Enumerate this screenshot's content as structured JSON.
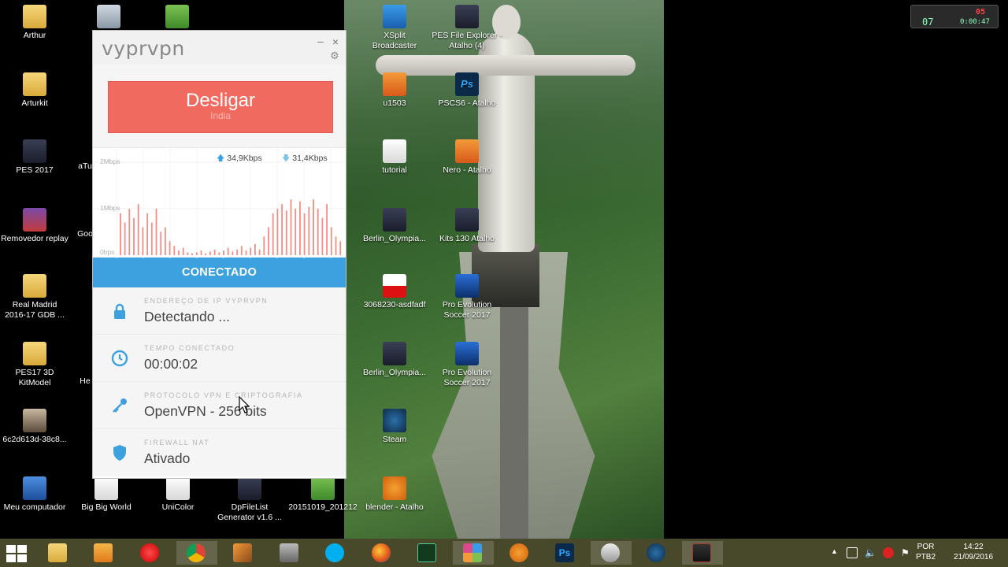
{
  "vpn": {
    "logo": "vyprvpn",
    "disconnect_label": "Desligar",
    "disconnect_sub": "India",
    "upload_rate": "34,9Kbps",
    "download_rate": "31,4Kbps",
    "graph_labels": [
      "2Mbps",
      "1Mbps",
      "0bps"
    ],
    "status": "CONECTADO",
    "rows": [
      {
        "label": "Endereço de IP VyprVPN",
        "value": "Detectando ...",
        "icon": "lock-icon"
      },
      {
        "label": "Tempo conectado",
        "value": "00:00:02",
        "icon": "clock-icon"
      },
      {
        "label": "Protocolo VPN e criptografia",
        "value": "OpenVPN - 256 bits",
        "icon": "key-icon"
      },
      {
        "label": "Firewall NAT",
        "value": "Ativado",
        "icon": "shield-icon"
      }
    ],
    "accent": "#3da1e0",
    "disconnect_color": "#f06a5f"
  },
  "desktop_icons": [
    {
      "label": "Arthur",
      "icon": "folder-icon"
    },
    {
      "label": "Arturkit",
      "icon": "folder-icon"
    },
    {
      "label": "PES 2017",
      "icon": "game-icon"
    },
    {
      "label": "Removedor replay",
      "icon": "winrar-icon"
    },
    {
      "label": "Real Madrid 2016-17 GDB ...",
      "icon": "folder-icon"
    },
    {
      "label": "PES17 3D KitModel",
      "icon": "folder-icon"
    },
    {
      "label": "6c2d613d-38c8...",
      "icon": "image-icon"
    },
    {
      "label": "Meu computador",
      "icon": "computer-icon"
    },
    {
      "label": "Big Big World",
      "icon": "audio-file-icon"
    },
    {
      "label": "UniColor",
      "icon": "app-icon"
    },
    {
      "label": "DpFileList Generator v1.6 ...",
      "icon": "app-icon"
    },
    {
      "label": "20151019_201212",
      "icon": "image-icon"
    },
    {
      "label": "XSplit Broadcaster",
      "icon": "xsplit-icon"
    },
    {
      "label": "PES File Explorer - Atalho (4)",
      "icon": "app-icon"
    },
    {
      "label": "u1503",
      "icon": "app-icon"
    },
    {
      "label": "PSCS6 - Atalho",
      "icon": "photoshop-icon"
    },
    {
      "label": "tutorial",
      "icon": "text-file-icon"
    },
    {
      "label": "Nero - Atalho",
      "icon": "nero-icon"
    },
    {
      "label": "Berlin_Olympia...",
      "icon": "image-icon"
    },
    {
      "label": "Kits 130 Atalho",
      "icon": "app-icon"
    },
    {
      "label": "3068230-asdfadf",
      "icon": "image-icon"
    },
    {
      "label": "Pro Evolution Soccer 2017",
      "icon": "game-icon"
    },
    {
      "label": "Berlin_Olympia...",
      "icon": "image-icon"
    },
    {
      "label": "Pro Evolution Soccer 2017",
      "icon": "game-icon"
    },
    {
      "label": "Steam",
      "icon": "steam-icon"
    },
    {
      "label": "blender - Atalho",
      "icon": "blender-icon"
    },
    {
      "label": "aTu",
      "icon": "app-icon"
    },
    {
      "label": "Goo",
      "icon": "app-icon"
    },
    {
      "label": "He",
      "icon": "app-icon"
    }
  ],
  "taskbar": {
    "lang_1": "POR",
    "lang_2": "PTB2",
    "time": "14:22",
    "date": "21/09/2016",
    "apps": [
      "file-explorer-icon",
      "media-player-icon",
      "record-icon",
      "chrome-icon",
      "tool-icon",
      "game-icon",
      "skype-icon",
      "firefox-icon",
      "terminal-icon",
      "paint-icon",
      "blender-icon",
      "photoshop-icon",
      "vpn-icon",
      "steam-icon",
      "settings-icon"
    ]
  },
  "recorder": {
    "frames": "07",
    "time": "0:00:47",
    "rec": "05"
  }
}
